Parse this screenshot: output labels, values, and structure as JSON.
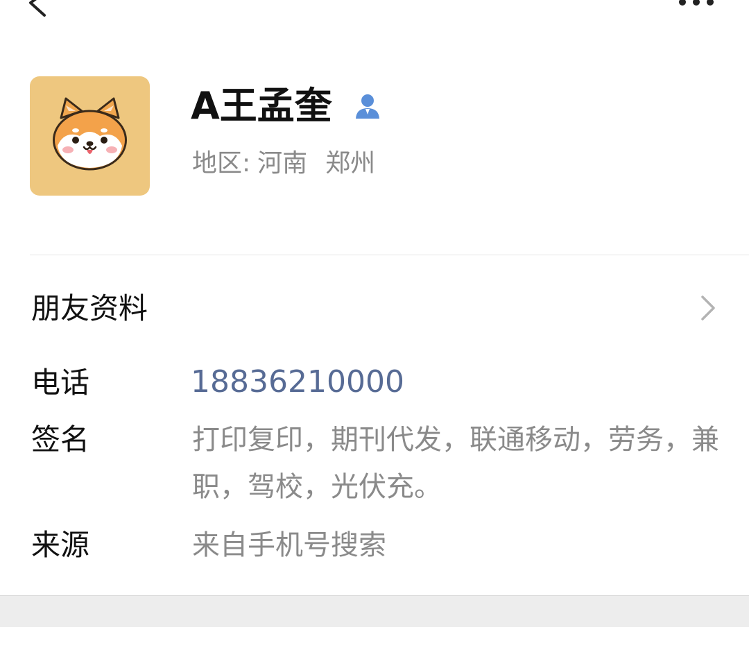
{
  "header": {
    "back_icon": "chevron-left-icon",
    "more_icon": "more-dots-icon"
  },
  "profile": {
    "avatar": "shiba-dog-avatar",
    "avatar_bg": "#eec77f",
    "name": "A王孟奎",
    "verified_icon": "person-icon",
    "verified_color": "#5a8fd9",
    "region_label": "地区:",
    "region_province": "河南",
    "region_city": "郑州"
  },
  "friend_profile": {
    "label": "朋友资料",
    "chevron_icon": "chevron-right-icon"
  },
  "info": {
    "phone_label": "电话",
    "phone_value": "18836210000",
    "phone_color": "#576b95",
    "signature_label": "签名",
    "signature_value": "打印复印，期刊代发，联通移动，劳务，兼职，驾校，光伏充。",
    "source_label": "来源",
    "source_value": "来自手机号搜索"
  }
}
